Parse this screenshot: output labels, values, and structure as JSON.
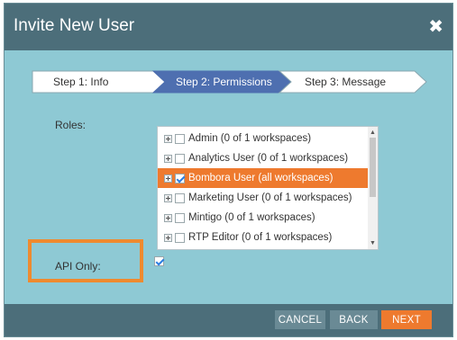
{
  "dialog": {
    "title": "Invite New User",
    "close_icon": "close-icon"
  },
  "steps": [
    {
      "label": "Step 1: Info",
      "active": false
    },
    {
      "label": "Step 2: Permissions",
      "active": true
    },
    {
      "label": "Step 3: Message",
      "active": false
    }
  ],
  "roles": {
    "label": "Roles:",
    "items": [
      {
        "label": "Admin (0 of 1 workspaces)",
        "checked": false,
        "selected": false
      },
      {
        "label": "Analytics User (0 of 1 workspaces)",
        "checked": false,
        "selected": false
      },
      {
        "label": "Bombora User (all workspaces)",
        "checked": true,
        "selected": true
      },
      {
        "label": "Marketing User (0 of 1 workspaces)",
        "checked": false,
        "selected": false
      },
      {
        "label": "Mintigo (0 of 1 workspaces)",
        "checked": false,
        "selected": false
      },
      {
        "label": "RTP Editor (0 of 1 workspaces)",
        "checked": false,
        "selected": false
      }
    ]
  },
  "api_only": {
    "label": "API Only:",
    "checked": true
  },
  "buttons": {
    "cancel": "CANCEL",
    "back": "BACK",
    "next": "NEXT"
  },
  "colors": {
    "accent": "#ee7a2e",
    "titlebar": "#4c6e7a",
    "body": "#8ec9d4"
  }
}
